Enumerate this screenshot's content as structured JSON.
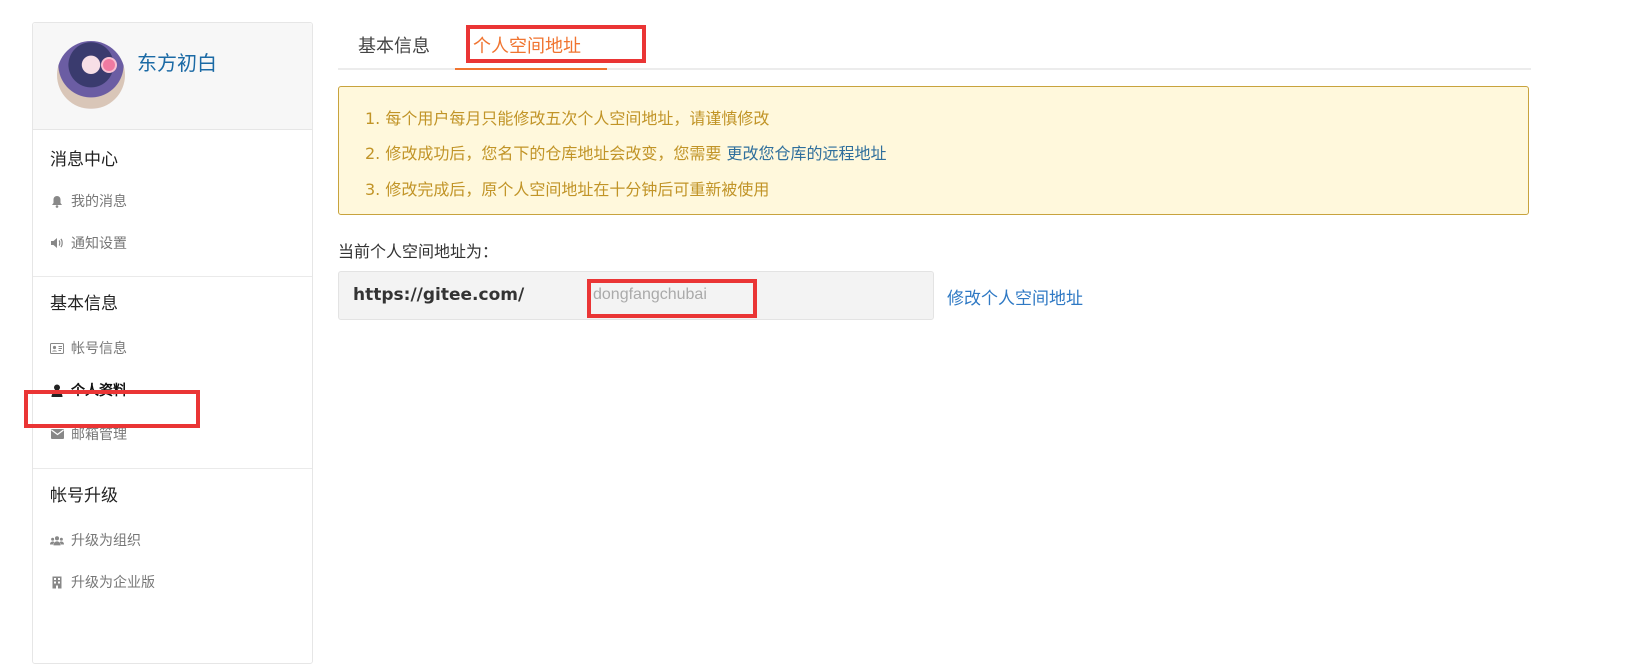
{
  "user": {
    "name": "东方初白"
  },
  "sidebar": {
    "sections": [
      {
        "title": "消息中心",
        "items": [
          {
            "label": "我的消息",
            "icon": "bell-icon"
          },
          {
            "label": "通知设置",
            "icon": "volume-icon"
          }
        ]
      },
      {
        "title": "基本信息",
        "items": [
          {
            "label": "帐号信息",
            "icon": "id-card-icon"
          },
          {
            "label": "个人资料",
            "icon": "user-icon",
            "active": true
          },
          {
            "label": "邮箱管理",
            "icon": "envelope-icon"
          }
        ]
      },
      {
        "title": "帐号升级",
        "items": [
          {
            "label": "升级为组织",
            "icon": "users-icon"
          },
          {
            "label": "升级为企业版",
            "icon": "building-icon"
          }
        ]
      }
    ]
  },
  "tabs": [
    {
      "label": "基本信息",
      "active": false
    },
    {
      "label": "个人空间地址",
      "active": true
    }
  ],
  "notice": {
    "line1": "1. 每个用户每月只能修改五次个人空间地址，请谨慎修改",
    "line2_prefix": "2. 修改成功后，您名下的仓库地址会改变，您需要 ",
    "line2_link": "更改您仓库的远程地址",
    "line3": "3. 修改完成后，原个人空间地址在十分钟后可重新被使用"
  },
  "current_address": {
    "label": "当前个人空间地址为：",
    "prefix": "https://gitee.com/",
    "value": "dongfangchubai"
  },
  "modify_link": "修改个人空间地址",
  "colors": {
    "accent": "#f07430",
    "link": "#2f79c4",
    "highlight": "#ea3535",
    "notice_bg": "#fff8dc",
    "notice_text": "#c19427"
  }
}
